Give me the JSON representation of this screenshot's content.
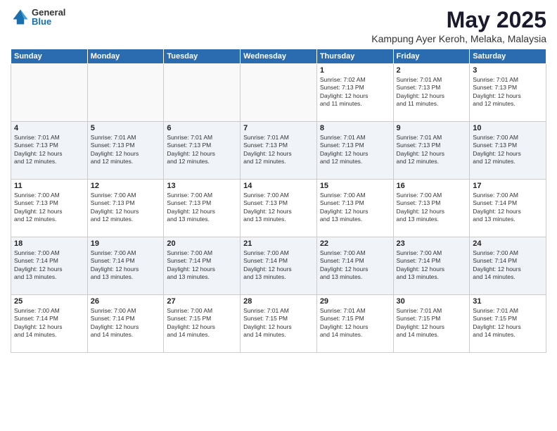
{
  "logo": {
    "general": "General",
    "blue": "Blue"
  },
  "title": "May 2025",
  "location": "Kampung Ayer Keroh, Melaka, Malaysia",
  "headers": [
    "Sunday",
    "Monday",
    "Tuesday",
    "Wednesday",
    "Thursday",
    "Friday",
    "Saturday"
  ],
  "weeks": [
    [
      {
        "day": "",
        "info": ""
      },
      {
        "day": "",
        "info": ""
      },
      {
        "day": "",
        "info": ""
      },
      {
        "day": "",
        "info": ""
      },
      {
        "day": "1",
        "info": "Sunrise: 7:02 AM\nSunset: 7:13 PM\nDaylight: 12 hours\nand 11 minutes."
      },
      {
        "day": "2",
        "info": "Sunrise: 7:01 AM\nSunset: 7:13 PM\nDaylight: 12 hours\nand 11 minutes."
      },
      {
        "day": "3",
        "info": "Sunrise: 7:01 AM\nSunset: 7:13 PM\nDaylight: 12 hours\nand 12 minutes."
      }
    ],
    [
      {
        "day": "4",
        "info": "Sunrise: 7:01 AM\nSunset: 7:13 PM\nDaylight: 12 hours\nand 12 minutes."
      },
      {
        "day": "5",
        "info": "Sunrise: 7:01 AM\nSunset: 7:13 PM\nDaylight: 12 hours\nand 12 minutes."
      },
      {
        "day": "6",
        "info": "Sunrise: 7:01 AM\nSunset: 7:13 PM\nDaylight: 12 hours\nand 12 minutes."
      },
      {
        "day": "7",
        "info": "Sunrise: 7:01 AM\nSunset: 7:13 PM\nDaylight: 12 hours\nand 12 minutes."
      },
      {
        "day": "8",
        "info": "Sunrise: 7:01 AM\nSunset: 7:13 PM\nDaylight: 12 hours\nand 12 minutes."
      },
      {
        "day": "9",
        "info": "Sunrise: 7:01 AM\nSunset: 7:13 PM\nDaylight: 12 hours\nand 12 minutes."
      },
      {
        "day": "10",
        "info": "Sunrise: 7:00 AM\nSunset: 7:13 PM\nDaylight: 12 hours\nand 12 minutes."
      }
    ],
    [
      {
        "day": "11",
        "info": "Sunrise: 7:00 AM\nSunset: 7:13 PM\nDaylight: 12 hours\nand 12 minutes."
      },
      {
        "day": "12",
        "info": "Sunrise: 7:00 AM\nSunset: 7:13 PM\nDaylight: 12 hours\nand 12 minutes."
      },
      {
        "day": "13",
        "info": "Sunrise: 7:00 AM\nSunset: 7:13 PM\nDaylight: 12 hours\nand 13 minutes."
      },
      {
        "day": "14",
        "info": "Sunrise: 7:00 AM\nSunset: 7:13 PM\nDaylight: 12 hours\nand 13 minutes."
      },
      {
        "day": "15",
        "info": "Sunrise: 7:00 AM\nSunset: 7:13 PM\nDaylight: 12 hours\nand 13 minutes."
      },
      {
        "day": "16",
        "info": "Sunrise: 7:00 AM\nSunset: 7:13 PM\nDaylight: 12 hours\nand 13 minutes."
      },
      {
        "day": "17",
        "info": "Sunrise: 7:00 AM\nSunset: 7:14 PM\nDaylight: 12 hours\nand 13 minutes."
      }
    ],
    [
      {
        "day": "18",
        "info": "Sunrise: 7:00 AM\nSunset: 7:14 PM\nDaylight: 12 hours\nand 13 minutes."
      },
      {
        "day": "19",
        "info": "Sunrise: 7:00 AM\nSunset: 7:14 PM\nDaylight: 12 hours\nand 13 minutes."
      },
      {
        "day": "20",
        "info": "Sunrise: 7:00 AM\nSunset: 7:14 PM\nDaylight: 12 hours\nand 13 minutes."
      },
      {
        "day": "21",
        "info": "Sunrise: 7:00 AM\nSunset: 7:14 PM\nDaylight: 12 hours\nand 13 minutes."
      },
      {
        "day": "22",
        "info": "Sunrise: 7:00 AM\nSunset: 7:14 PM\nDaylight: 12 hours\nand 13 minutes."
      },
      {
        "day": "23",
        "info": "Sunrise: 7:00 AM\nSunset: 7:14 PM\nDaylight: 12 hours\nand 13 minutes."
      },
      {
        "day": "24",
        "info": "Sunrise: 7:00 AM\nSunset: 7:14 PM\nDaylight: 12 hours\nand 14 minutes."
      }
    ],
    [
      {
        "day": "25",
        "info": "Sunrise: 7:00 AM\nSunset: 7:14 PM\nDaylight: 12 hours\nand 14 minutes."
      },
      {
        "day": "26",
        "info": "Sunrise: 7:00 AM\nSunset: 7:14 PM\nDaylight: 12 hours\nand 14 minutes."
      },
      {
        "day": "27",
        "info": "Sunrise: 7:00 AM\nSunset: 7:15 PM\nDaylight: 12 hours\nand 14 minutes."
      },
      {
        "day": "28",
        "info": "Sunrise: 7:01 AM\nSunset: 7:15 PM\nDaylight: 12 hours\nand 14 minutes."
      },
      {
        "day": "29",
        "info": "Sunrise: 7:01 AM\nSunset: 7:15 PM\nDaylight: 12 hours\nand 14 minutes."
      },
      {
        "day": "30",
        "info": "Sunrise: 7:01 AM\nSunset: 7:15 PM\nDaylight: 12 hours\nand 14 minutes."
      },
      {
        "day": "31",
        "info": "Sunrise: 7:01 AM\nSunset: 7:15 PM\nDaylight: 12 hours\nand 14 minutes."
      }
    ]
  ]
}
